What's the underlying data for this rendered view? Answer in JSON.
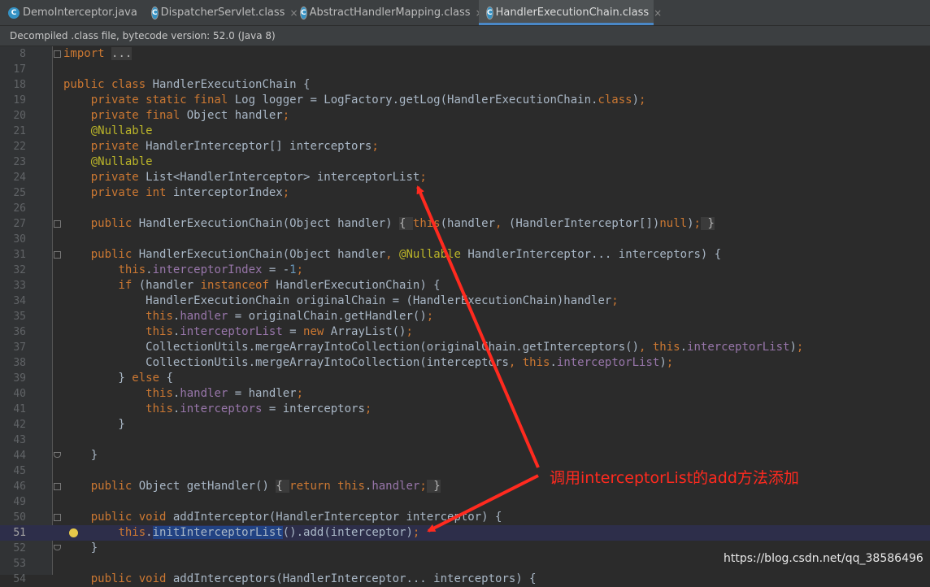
{
  "tabs": [
    {
      "label": "DemoInterceptor.java",
      "icon": "java-class-icon",
      "active": false
    },
    {
      "label": "DispatcherServlet.class",
      "icon": "compiled-class-icon",
      "active": false
    },
    {
      "label": "AbstractHandlerMapping.class",
      "icon": "compiled-class-icon",
      "active": false
    },
    {
      "label": "HandlerExecutionChain.class",
      "icon": "compiled-class-icon",
      "active": true
    }
  ],
  "tab_icon_glyph": "C",
  "tab_close_glyph": "×",
  "banner": "Decompiled .class file, bytecode version: 52.0 (Java 8)",
  "lines": [
    {
      "num": "8",
      "segs": [
        {
          "c": "k",
          "t": "import"
        },
        {
          "c": "",
          "t": " "
        },
        {
          "c": "fold",
          "t": "..."
        }
      ]
    },
    {
      "num": "17",
      "segs": []
    },
    {
      "num": "18",
      "segs": [
        {
          "c": "k",
          "t": "public class"
        },
        {
          "c": "",
          "t": " HandlerExecutionChain {"
        }
      ]
    },
    {
      "num": "19",
      "segs": [
        {
          "c": "",
          "t": "    "
        },
        {
          "c": "k",
          "t": "private static final"
        },
        {
          "c": "",
          "t": " Log logger = LogFactory.getLog(HandlerExecutionChain."
        },
        {
          "c": "k",
          "t": "class"
        },
        {
          "c": "",
          "t": ")"
        },
        {
          "c": "k",
          "t": ";"
        }
      ]
    },
    {
      "num": "20",
      "segs": [
        {
          "c": "",
          "t": "    "
        },
        {
          "c": "k",
          "t": "private final"
        },
        {
          "c": "",
          "t": " Object handler"
        },
        {
          "c": "k",
          "t": ";"
        }
      ]
    },
    {
      "num": "21",
      "segs": [
        {
          "c": "",
          "t": "    "
        },
        {
          "c": "a",
          "t": "@Nullable"
        }
      ]
    },
    {
      "num": "22",
      "segs": [
        {
          "c": "",
          "t": "    "
        },
        {
          "c": "k",
          "t": "private"
        },
        {
          "c": "",
          "t": " HandlerInterceptor[] interceptors"
        },
        {
          "c": "k",
          "t": ";"
        }
      ]
    },
    {
      "num": "23",
      "segs": [
        {
          "c": "",
          "t": "    "
        },
        {
          "c": "a",
          "t": "@Nullable"
        }
      ]
    },
    {
      "num": "24",
      "segs": [
        {
          "c": "",
          "t": "    "
        },
        {
          "c": "k",
          "t": "private"
        },
        {
          "c": "",
          "t": " List<HandlerInterceptor> interceptorList"
        },
        {
          "c": "k",
          "t": ";"
        }
      ]
    },
    {
      "num": "25",
      "segs": [
        {
          "c": "",
          "t": "    "
        },
        {
          "c": "k",
          "t": "private int"
        },
        {
          "c": "",
          "t": " interceptorIndex"
        },
        {
          "c": "k",
          "t": ";"
        }
      ]
    },
    {
      "num": "26",
      "segs": []
    },
    {
      "num": "27",
      "segs": [
        {
          "c": "",
          "t": "    "
        },
        {
          "c": "k",
          "t": "public"
        },
        {
          "c": "",
          "t": " HandlerExecutionChain(Object handler) "
        },
        {
          "c": "fold",
          "t": "{ "
        },
        {
          "c": "k",
          "t": "this"
        },
        {
          "c": "",
          "t": "(handler"
        },
        {
          "c": "k",
          "t": ","
        },
        {
          "c": "",
          "t": " (HandlerInterceptor[])"
        },
        {
          "c": "k",
          "t": "null"
        },
        {
          "c": "",
          "t": ")"
        },
        {
          "c": "k",
          "t": ";"
        },
        {
          "c": "fold",
          "t": " }"
        }
      ]
    },
    {
      "num": "30",
      "segs": []
    },
    {
      "num": "31",
      "segs": [
        {
          "c": "",
          "t": "    "
        },
        {
          "c": "k",
          "t": "public"
        },
        {
          "c": "",
          "t": " HandlerExecutionChain(Object handler"
        },
        {
          "c": "k",
          "t": ","
        },
        {
          "c": "",
          "t": " "
        },
        {
          "c": "a",
          "t": "@Nullable"
        },
        {
          "c": "",
          "t": " HandlerInterceptor... interceptors) {"
        }
      ]
    },
    {
      "num": "32",
      "segs": [
        {
          "c": "",
          "t": "        "
        },
        {
          "c": "k",
          "t": "this"
        },
        {
          "c": "",
          "t": "."
        },
        {
          "c": "f",
          "t": "interceptorIndex"
        },
        {
          "c": "",
          "t": " = -"
        },
        {
          "c": "n",
          "t": "1"
        },
        {
          "c": "k",
          "t": ";"
        }
      ]
    },
    {
      "num": "33",
      "segs": [
        {
          "c": "",
          "t": "        "
        },
        {
          "c": "k",
          "t": "if"
        },
        {
          "c": "",
          "t": " (handler "
        },
        {
          "c": "k",
          "t": "instanceof"
        },
        {
          "c": "",
          "t": " HandlerExecutionChain) {"
        }
      ]
    },
    {
      "num": "34",
      "segs": [
        {
          "c": "",
          "t": "            HandlerExecutionChain originalChain = (HandlerExecutionChain)handler"
        },
        {
          "c": "k",
          "t": ";"
        }
      ]
    },
    {
      "num": "35",
      "segs": [
        {
          "c": "",
          "t": "            "
        },
        {
          "c": "k",
          "t": "this"
        },
        {
          "c": "",
          "t": "."
        },
        {
          "c": "f",
          "t": "handler"
        },
        {
          "c": "",
          "t": " = originalChain.getHandler()"
        },
        {
          "c": "k",
          "t": ";"
        }
      ]
    },
    {
      "num": "36",
      "segs": [
        {
          "c": "",
          "t": "            "
        },
        {
          "c": "k",
          "t": "this"
        },
        {
          "c": "",
          "t": "."
        },
        {
          "c": "f",
          "t": "interceptorList"
        },
        {
          "c": "",
          "t": " = "
        },
        {
          "c": "k",
          "t": "new"
        },
        {
          "c": "",
          "t": " ArrayList()"
        },
        {
          "c": "k",
          "t": ";"
        }
      ]
    },
    {
      "num": "37",
      "segs": [
        {
          "c": "",
          "t": "            CollectionUtils.mergeArrayIntoCollection(originalChain.getInterceptors()"
        },
        {
          "c": "k",
          "t": ", this"
        },
        {
          "c": "",
          "t": "."
        },
        {
          "c": "f",
          "t": "interceptorList"
        },
        {
          "c": "",
          "t": ")"
        },
        {
          "c": "k",
          "t": ";"
        }
      ]
    },
    {
      "num": "38",
      "segs": [
        {
          "c": "",
          "t": "            CollectionUtils.mergeArrayIntoCollection(interceptors"
        },
        {
          "c": "k",
          "t": ", this"
        },
        {
          "c": "",
          "t": "."
        },
        {
          "c": "f",
          "t": "interceptorList"
        },
        {
          "c": "",
          "t": ")"
        },
        {
          "c": "k",
          "t": ";"
        }
      ]
    },
    {
      "num": "39",
      "segs": [
        {
          "c": "",
          "t": "        } "
        },
        {
          "c": "k",
          "t": "else"
        },
        {
          "c": "",
          "t": " {"
        }
      ]
    },
    {
      "num": "40",
      "segs": [
        {
          "c": "",
          "t": "            "
        },
        {
          "c": "k",
          "t": "this"
        },
        {
          "c": "",
          "t": "."
        },
        {
          "c": "f",
          "t": "handler"
        },
        {
          "c": "",
          "t": " = handler"
        },
        {
          "c": "k",
          "t": ";"
        }
      ]
    },
    {
      "num": "41",
      "segs": [
        {
          "c": "",
          "t": "            "
        },
        {
          "c": "k",
          "t": "this"
        },
        {
          "c": "",
          "t": "."
        },
        {
          "c": "f",
          "t": "interceptors"
        },
        {
          "c": "",
          "t": " = interceptors"
        },
        {
          "c": "k",
          "t": ";"
        }
      ]
    },
    {
      "num": "42",
      "segs": [
        {
          "c": "",
          "t": "        }"
        }
      ]
    },
    {
      "num": "43",
      "segs": []
    },
    {
      "num": "44",
      "segs": [
        {
          "c": "",
          "t": "    }"
        }
      ]
    },
    {
      "num": "45",
      "segs": []
    },
    {
      "num": "46",
      "segs": [
        {
          "c": "",
          "t": "    "
        },
        {
          "c": "k",
          "t": "public"
        },
        {
          "c": "",
          "t": " Object getHandler() "
        },
        {
          "c": "fold",
          "t": "{ "
        },
        {
          "c": "k",
          "t": "return this"
        },
        {
          "c": "",
          "t": "."
        },
        {
          "c": "f",
          "t": "handler"
        },
        {
          "c": "k",
          "t": ";"
        },
        {
          "c": "fold",
          "t": " }"
        }
      ]
    },
    {
      "num": "49",
      "segs": []
    },
    {
      "num": "50",
      "segs": [
        {
          "c": "",
          "t": "    "
        },
        {
          "c": "k",
          "t": "public void"
        },
        {
          "c": "",
          "t": " addInterceptor(HandlerInterceptor interceptor) {"
        }
      ]
    },
    {
      "num": "51",
      "segs": [
        {
          "c": "",
          "t": "        "
        },
        {
          "c": "k",
          "t": "this"
        },
        {
          "c": "",
          "t": "."
        },
        {
          "c": "sel",
          "t": "initInterceptorList"
        },
        {
          "c": "",
          "t": "().add(interceptor)"
        },
        {
          "c": "k",
          "t": ";"
        }
      ]
    },
    {
      "num": "52",
      "segs": [
        {
          "c": "",
          "t": "    }"
        }
      ]
    },
    {
      "num": "53",
      "segs": []
    },
    {
      "num": "54",
      "segs": [
        {
          "c": "",
          "t": "    "
        },
        {
          "c": "k",
          "t": "public void"
        },
        {
          "c": "",
          "t": " addInterceptors(HandlerInterceptor... interceptors) {"
        }
      ]
    }
  ],
  "current_line": "51",
  "annotation": "调用interceptorList的add方法添加",
  "watermark": "https://blog.csdn.net/qq_38586496",
  "colors": {
    "keyword": "#cc7832",
    "number": "#6897bb",
    "annotation": "#bbb529",
    "field": "#9876aa",
    "arrow": "#ff2a1f",
    "selection": "#214283"
  }
}
